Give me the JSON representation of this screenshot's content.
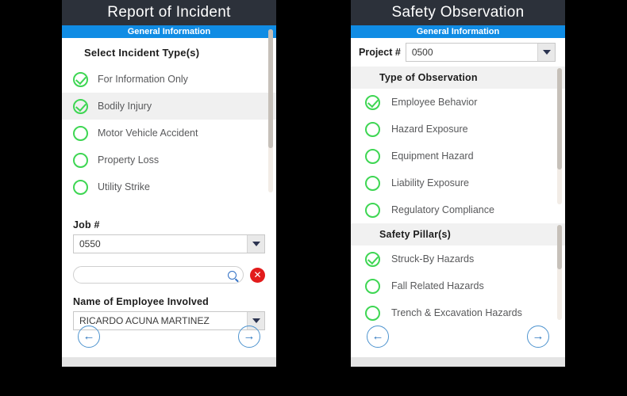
{
  "left_panel": {
    "title": "Report of Incident",
    "subtitle": "General Information",
    "section_heading": "Select Incident Type(s)",
    "incident_types": [
      {
        "label": "For Information Only",
        "checked": true,
        "highlighted": false
      },
      {
        "label": "Bodily Injury",
        "checked": true,
        "highlighted": true
      },
      {
        "label": "Motor Vehicle Accident",
        "checked": false,
        "highlighted": false
      },
      {
        "label": "Property Loss",
        "checked": false,
        "highlighted": false
      },
      {
        "label": "Utility Strike",
        "checked": false,
        "highlighted": false
      }
    ],
    "job_field": {
      "label": "Job #",
      "value": "0550"
    },
    "search": {
      "value": "",
      "placeholder": "",
      "search_icon": "search-icon",
      "clear_icon": "close-icon"
    },
    "employee_field": {
      "label": "Name of Employee Involved",
      "value": "RICARDO ACUNA MARTINEZ"
    },
    "nav": {
      "back_icon": "arrow-left-icon",
      "next_icon": "arrow-right-icon",
      "back_label": "←",
      "next_label": "→"
    }
  },
  "right_panel": {
    "title": "Safety Observation",
    "subtitle": "General Information",
    "project_field": {
      "label": "Project #",
      "value": "0500"
    },
    "observation_header": "Type of Observation",
    "observation_types": [
      {
        "label": "Employee Behavior",
        "checked": true
      },
      {
        "label": "Hazard Exposure",
        "checked": false
      },
      {
        "label": "Equipment Hazard",
        "checked": false
      },
      {
        "label": "Liability Exposure",
        "checked": false
      },
      {
        "label": "Regulatory Compliance",
        "checked": false
      }
    ],
    "pillar_header": "Safety Pillar(s)",
    "pillars": [
      {
        "label": "Struck-By Hazards",
        "checked": true
      },
      {
        "label": "Fall Related Hazards",
        "checked": false
      },
      {
        "label": "Trench & Excavation Hazards",
        "checked": false
      }
    ],
    "nav": {
      "back_icon": "arrow-left-icon",
      "next_icon": "arrow-right-icon",
      "back_label": "←",
      "next_label": "→"
    }
  },
  "colors": {
    "header_bg": "#2c313a",
    "accent_blue": "#108ce4",
    "check_green": "#3ed653",
    "clear_red": "#e21b1b",
    "nav_blue": "#4d93cf",
    "background": "#000000"
  }
}
